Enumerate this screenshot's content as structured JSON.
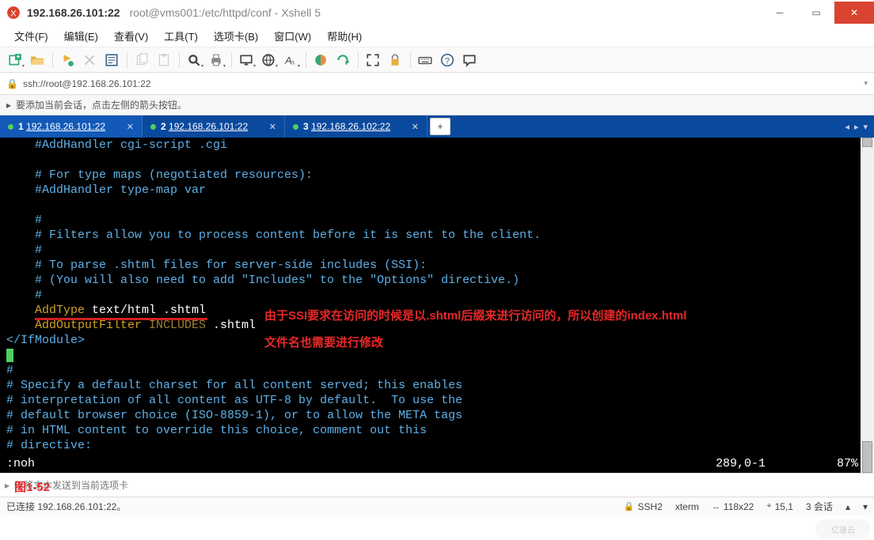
{
  "titlebar": {
    "host": "192.168.26.101:22",
    "subtitle": "root@vms001:/etc/httpd/conf - Xshell 5"
  },
  "menubar": {
    "items": [
      {
        "id": "file",
        "label": "文件(F)"
      },
      {
        "id": "edit",
        "label": "编辑(E)"
      },
      {
        "id": "view",
        "label": "查看(V)"
      },
      {
        "id": "tools",
        "label": "工具(T)"
      },
      {
        "id": "tabs",
        "label": "选项卡(B)"
      },
      {
        "id": "window",
        "label": "窗口(W)"
      },
      {
        "id": "help",
        "label": "帮助(H)"
      }
    ]
  },
  "addressbar": {
    "url": "ssh://root@192.168.26.101:22"
  },
  "infobar": {
    "text": "要添加当前会话，点击左侧的箭头按钮。"
  },
  "tabs": [
    {
      "index": "1",
      "label": "192.168.26.101:22",
      "active": true
    },
    {
      "index": "2",
      "label": "192.168.26.101:22",
      "active": false
    },
    {
      "index": "3",
      "label": "192.168.26.102:22",
      "active": false
    }
  ],
  "terminal": {
    "lines": [
      {
        "indent": 4,
        "cls": "t-c-comment",
        "text": "#AddHandler cgi-script .cgi"
      },
      {
        "indent": 4,
        "cls": "",
        "text": ""
      },
      {
        "indent": 4,
        "cls": "t-c-comment",
        "text": "# For type maps (negotiated resources):"
      },
      {
        "indent": 4,
        "cls": "t-c-comment",
        "text": "#AddHandler type-map var"
      },
      {
        "indent": 4,
        "cls": "",
        "text": ""
      },
      {
        "indent": 4,
        "cls": "t-c-comment",
        "text": "#"
      },
      {
        "indent": 4,
        "cls": "t-c-comment",
        "text": "# Filters allow you to process content before it is sent to the client."
      },
      {
        "indent": 4,
        "cls": "t-c-comment",
        "text": "#"
      },
      {
        "indent": 4,
        "cls": "t-c-comment",
        "text": "# To parse .shtml files for server-side includes (SSI):"
      },
      {
        "indent": 4,
        "cls": "t-c-comment",
        "text": "# (You will also need to add \"Includes\" to the \"Options\" directive.)"
      },
      {
        "indent": 4,
        "cls": "t-c-comment",
        "text": "#"
      }
    ],
    "addtype_keyword": "AddType",
    "addtype_rest": " text/html .shtml",
    "addoutput_keyword": "AddOutputFilter",
    "addoutput_include": " INCLUDES",
    "addoutput_rest": " .shtml",
    "close_tag": "</IfModule>",
    "lower": [
      {
        "cls": "t-c-comment",
        "text": "#"
      },
      {
        "cls": "t-c-comment",
        "text": "# Specify a default charset for all content served; this enables"
      },
      {
        "cls": "t-c-comment",
        "text": "# interpretation of all content as UTF-8 by default.  To use the"
      },
      {
        "cls": "t-c-comment",
        "text": "# default browser choice (ISO-8859-1), or to allow the META tags"
      },
      {
        "cls": "t-c-comment",
        "text": "# in HTML content to override this choice, comment out this"
      },
      {
        "cls": "t-c-comment",
        "text": "# directive:"
      }
    ],
    "vim_cmd": ":noh",
    "vim_pos": "289,0-1",
    "vim_pct": "87%"
  },
  "annotation": {
    "line1": "由于SSI要求在访问的时候是以.shtml后缀来进行访问的，所以创建的index.html",
    "line2": "文件名也需要进行修改",
    "figure": "图1-52"
  },
  "inputrow": {
    "placeholder": "仅将文本发送到当前选项卡"
  },
  "statusbar": {
    "connected": "已连接 192.168.26.101:22。",
    "ssh": "SSH2",
    "term": "xterm",
    "size": "118x22",
    "cursor": "15,1",
    "sessions": "3 会话"
  },
  "icons": {
    "new": "new-icon",
    "open": "open-icon",
    "props": "props-icon",
    "copy": "copy-icon",
    "paste": "paste-icon",
    "find": "find-icon",
    "print": "print-icon",
    "view": "view-icon",
    "lang": "lang-icon",
    "font": "font-icon",
    "refresh": "refresh-icon",
    "expand": "expand-icon",
    "lock": "lock-icon",
    "keyboard": "keyboard-icon",
    "help": "help-icon",
    "chat": "chat-icon"
  }
}
